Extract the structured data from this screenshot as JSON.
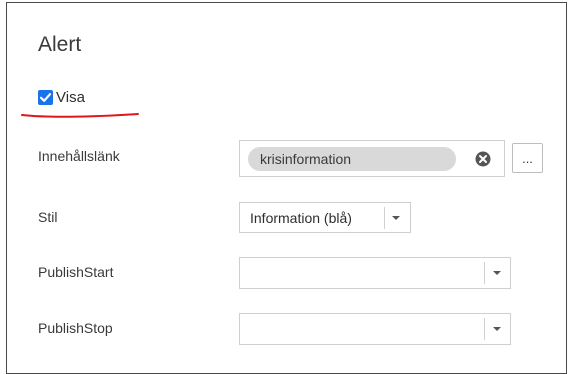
{
  "panel": {
    "title": "Alert"
  },
  "visa": {
    "label": "Visa",
    "checked": true,
    "accent_color": "#1a73e8",
    "annotation_color": "#e0161b"
  },
  "fields": {
    "content_link": {
      "label": "Innehållslänk",
      "value": "krisinformation",
      "browse_label": "..."
    },
    "style": {
      "label": "Stil",
      "value": "Information (blå)"
    },
    "publish_start": {
      "label": "PublishStart",
      "value": ""
    },
    "publish_stop": {
      "label": "PublishStop",
      "value": ""
    }
  },
  "icons": {
    "clear": "clear-circle-x-icon",
    "dropdown": "chevron-down-icon",
    "check": "checkmark-icon"
  }
}
